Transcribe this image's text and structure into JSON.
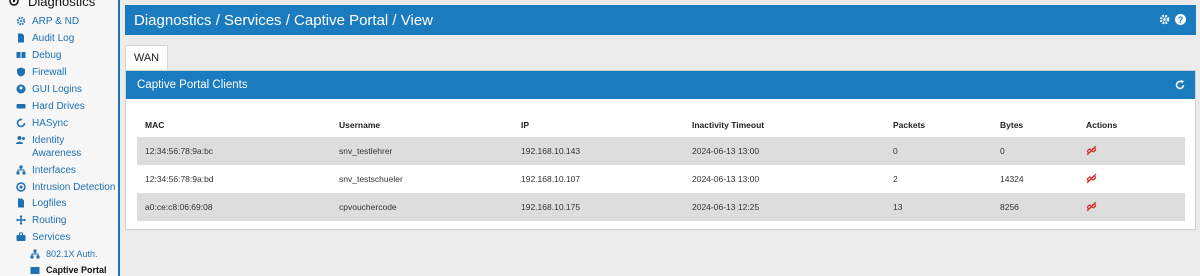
{
  "sidebar": {
    "header_label": "Diagnostics",
    "items": [
      {
        "label": "ARP & ND"
      },
      {
        "label": "Audit Log"
      },
      {
        "label": "Debug"
      },
      {
        "label": "Firewall"
      },
      {
        "label": "GUI Logins"
      },
      {
        "label": "Hard Drives"
      },
      {
        "label": "HASync"
      },
      {
        "label": "Identity Awareness"
      },
      {
        "label": "Interfaces"
      },
      {
        "label": "Intrusion Detection"
      },
      {
        "label": "Logfiles"
      },
      {
        "label": "Routing"
      },
      {
        "label": "Services"
      },
      {
        "label": "802.1X Auth."
      },
      {
        "label": "Captive Portal"
      }
    ]
  },
  "header": {
    "breadcrumb": "Diagnostics / Services / Captive Portal / View"
  },
  "tabs": [
    {
      "label": "WAN"
    }
  ],
  "panel": {
    "title": "Captive Portal Clients",
    "columns": [
      "MAC",
      "Username",
      "IP",
      "Inactivity Timeout",
      "Packets",
      "Bytes",
      "Actions"
    ],
    "rows": [
      {
        "mac": "12:34:56:78:9a:bc",
        "username": "snv_testlehrer",
        "ip": "192.168.10.143",
        "timeout": "2024-06-13 13:00",
        "packets": "0",
        "bytes": "0"
      },
      {
        "mac": "12:34:56:78:9a:bd",
        "username": "snv_testschueler",
        "ip": "192.168.10.107",
        "timeout": "2024-06-13 13:00",
        "packets": "2",
        "bytes": "14324"
      },
      {
        "mac": "a0:ce:c8:06:69:08",
        "username": "cpvouchercode",
        "ip": "192.168.10.175",
        "timeout": "2024-06-13 12:25",
        "packets": "13",
        "bytes": "8256"
      }
    ]
  },
  "icons": {
    "header_settings": "gear-icon",
    "header_help": "help-icon",
    "panel_refresh": "refresh-icon",
    "row_action": "disconnect-icon"
  },
  "colors": {
    "brand": "#1a7cbf",
    "link": "#1c70b4",
    "action_red": "#e03030"
  }
}
